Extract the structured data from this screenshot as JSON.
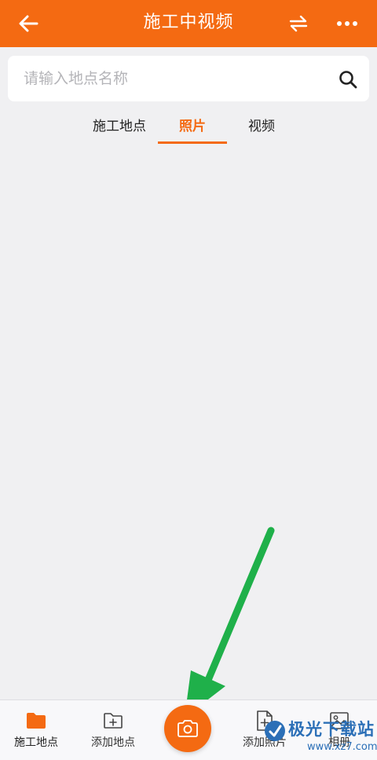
{
  "header": {
    "title": "施工中视频",
    "back_icon": "arrow-left-icon",
    "swap_icon": "swap-arrows-icon",
    "more_icon": "more-dots-icon",
    "color": "#f46a12"
  },
  "search": {
    "placeholder": "请输入地点名称",
    "icon": "search-icon"
  },
  "tabs": [
    {
      "label": "施工地点",
      "active": false
    },
    {
      "label": "照片",
      "active": true
    },
    {
      "label": "视频",
      "active": false
    }
  ],
  "bottom_nav": [
    {
      "label": "施工地点",
      "icon": "folder-icon",
      "active": true
    },
    {
      "label": "添加地点",
      "icon": "folder-add-icon",
      "active": false
    },
    {
      "label": "",
      "icon": "camera-icon",
      "active": false
    },
    {
      "label": "添加照片",
      "icon": "file-add-icon",
      "active": false
    },
    {
      "label": "相册",
      "icon": "image-album-icon",
      "active": false
    }
  ],
  "annotation": {
    "arrow_color": "#1fb04a"
  },
  "watermark": {
    "brand": "极光下载站",
    "url": "www.xz7.com"
  },
  "colors": {
    "accent": "#f46a12",
    "background": "#f0f0f2",
    "watermark": "#2b6fb7"
  }
}
